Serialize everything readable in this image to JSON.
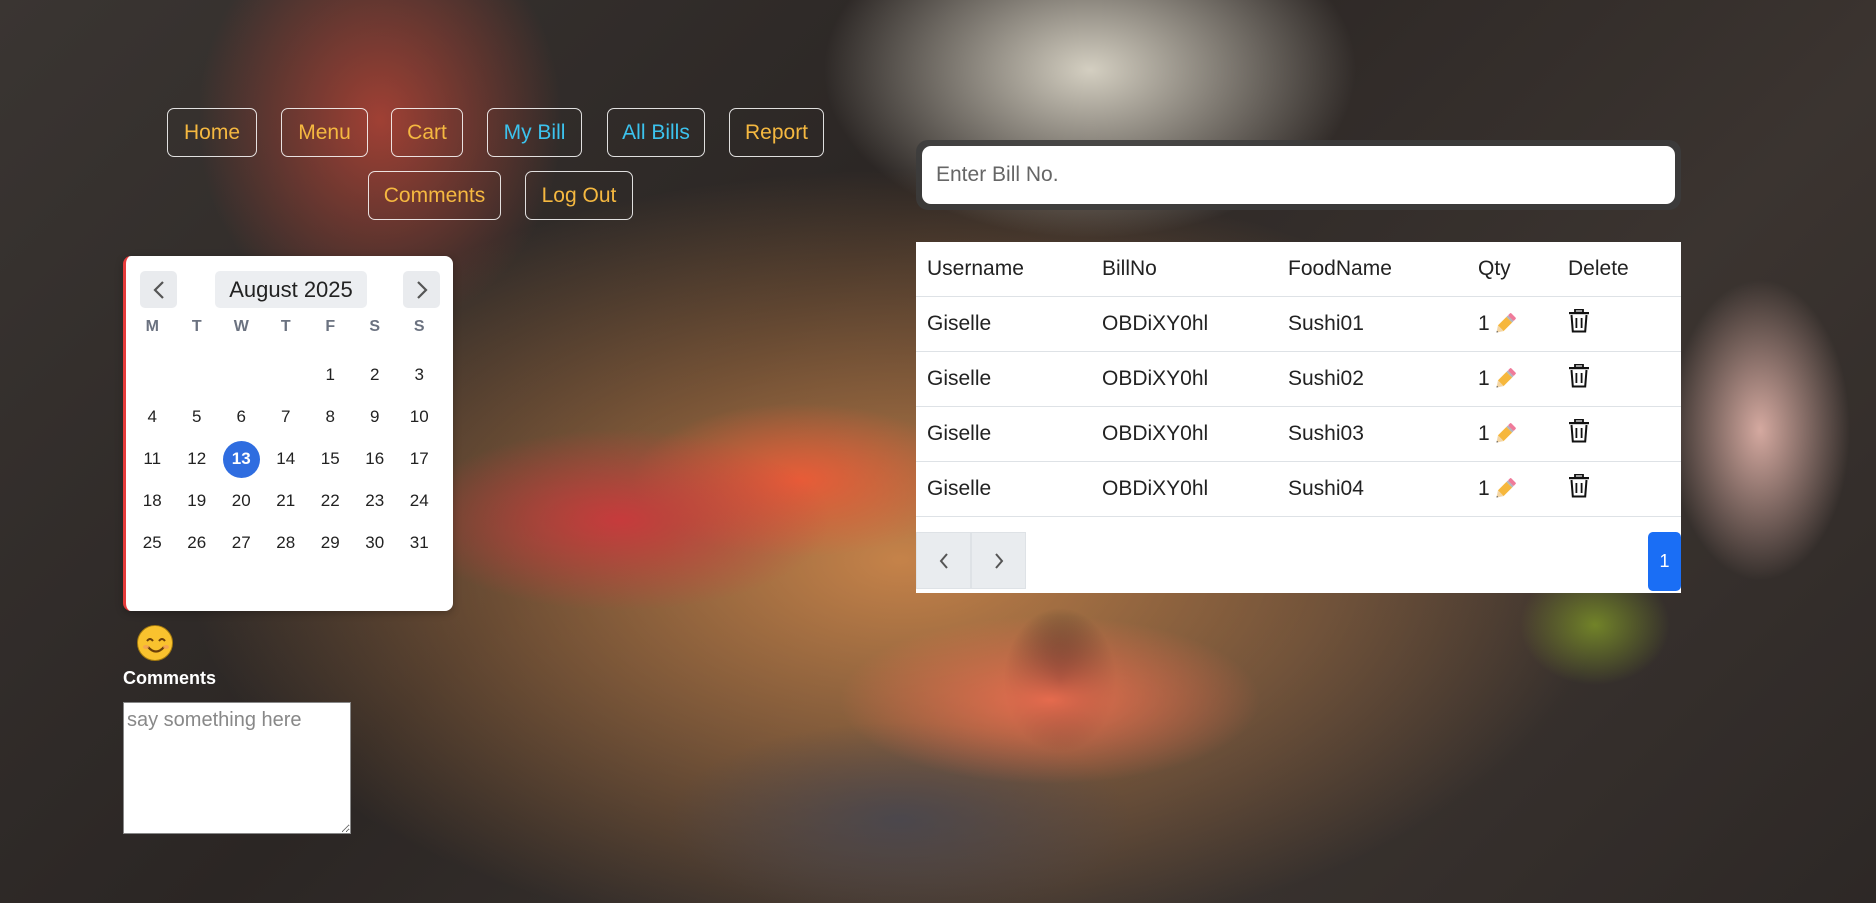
{
  "nav": {
    "home": "Home",
    "menu": "Menu",
    "cart": "Cart",
    "my_bill": "My Bill",
    "all_bills": "All Bills",
    "report": "Report",
    "comments": "Comments",
    "log_out": "Log Out"
  },
  "colors": {
    "nav_text": "#f5b840",
    "nav_active_text": "#3cc3ee",
    "today_highlight": "#2f6de0",
    "page_button": "#1a6ef5"
  },
  "calendar": {
    "title": "August 2025",
    "weekdays": [
      "M",
      "T",
      "W",
      "T",
      "F",
      "S",
      "S"
    ],
    "selected_day": "13",
    "weeks": [
      [
        "",
        "",
        "",
        "",
        "1",
        "2",
        "3"
      ],
      [
        "4",
        "5",
        "6",
        "7",
        "8",
        "9",
        "10"
      ],
      [
        "11",
        "12",
        "13",
        "14",
        "15",
        "16",
        "17"
      ],
      [
        "18",
        "19",
        "20",
        "21",
        "22",
        "23",
        "24"
      ],
      [
        "25",
        "26",
        "27",
        "28",
        "29",
        "30",
        "31"
      ]
    ]
  },
  "comments": {
    "label": "Comments",
    "placeholder": "say something here",
    "emoji": "smiling-face-icon"
  },
  "search": {
    "placeholder": "Enter Bill No."
  },
  "table": {
    "headers": {
      "username": "Username",
      "billno": "BillNo",
      "foodname": "FoodName",
      "qty": "Qty",
      "delete": "Delete"
    },
    "rows": [
      {
        "username": "Giselle",
        "billno": "OBDiXY0hl",
        "foodname": "Sushi01",
        "qty": "1"
      },
      {
        "username": "Giselle",
        "billno": "OBDiXY0hl",
        "foodname": "Sushi02",
        "qty": "1"
      },
      {
        "username": "Giselle",
        "billno": "OBDiXY0hl",
        "foodname": "Sushi03",
        "qty": "1"
      },
      {
        "username": "Giselle",
        "billno": "OBDiXY0hl",
        "foodname": "Sushi04",
        "qty": "1"
      }
    ]
  },
  "pagination": {
    "current_page": "1"
  }
}
